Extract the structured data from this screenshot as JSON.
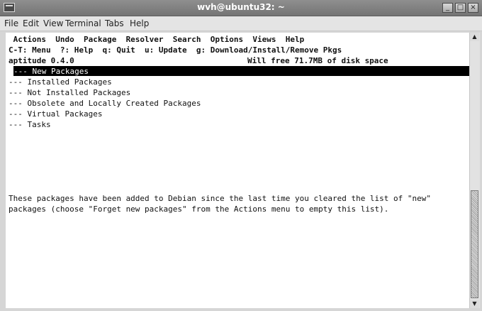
{
  "window": {
    "title": "wvh@ubuntu32: ~",
    "controls": {
      "minimize": "_",
      "maximize": "□",
      "close": "×"
    }
  },
  "menubar": [
    "File",
    "Edit",
    "View",
    "Terminal",
    "Tabs",
    "Help"
  ],
  "aptitude": {
    "menu_line": " Actions  Undo  Package  Resolver  Search  Options  Views  Help",
    "help_line": "C-T: Menu  ?: Help  q: Quit  u: Update  g: Download/Install/Remove Pkgs",
    "status_left": "aptitude 0.4.0",
    "status_right": "Will free 71.7MB of disk space",
    "tree": [
      "--- New Packages",
      "--- Installed Packages",
      "--- Not Installed Packages",
      "--- Obsolete and Locally Created Packages",
      "--- Virtual Packages",
      "--- Tasks"
    ],
    "selected_index": 0,
    "description": [
      "These packages have been added to Debian since the last time you cleared the list of \"new\"",
      "packages (choose \"Forget new packages\" from the Actions menu to empty this list)."
    ]
  },
  "scrollbar": {
    "up": "▲",
    "down": "▼"
  }
}
